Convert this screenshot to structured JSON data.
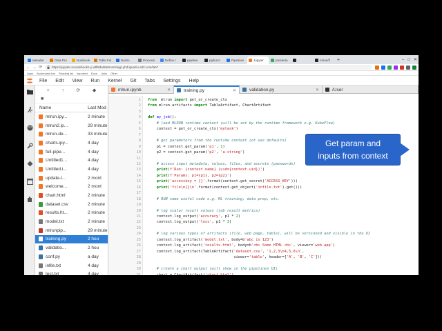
{
  "browser": {
    "tabs": [
      {
        "label": "Metadat",
        "color": "#1a73e8"
      },
      {
        "label": "Data Pro",
        "color": "#e37400"
      },
      {
        "label": "Notebook",
        "color": "#f9ab00"
      },
      {
        "label": "Table Ful",
        "color": "#e37400"
      },
      {
        "label": "Nuclio",
        "color": "#1a73e8"
      },
      {
        "label": "Processi",
        "color": "#777777"
      },
      {
        "label": "Define t",
        "color": "#4285f4"
      },
      {
        "label": "pipeline",
        "color": "#222222"
      },
      {
        "label": "pipfunct",
        "color": "#222222"
      },
      {
        "label": "Pipelines",
        "color": "#1a73e8"
      },
      {
        "label": "Jupyter",
        "color": "#f37626",
        "active": true
      },
      {
        "label": "presenta",
        "color": "#34a853"
      },
      {
        "label": "",
        "color": "#222222"
      },
      {
        "label": "mlrun/fl",
        "color": "#222222"
      }
    ],
    "new_tab": "+",
    "window_controls": [
      "–",
      "□",
      "✕"
    ],
    "nav": {
      "back": "←",
      "forward": "→",
      "reload": "⟳"
    },
    "url": "https://jupyter-noootebook1-y-wfll8dwlkle8-terrnayp.yhd.lguazio-sd2.com/lab?",
    "extension_colors": [
      "#e8710a",
      "#1a73e8",
      "#34a853",
      "#9334e6",
      "#d93025",
      "#5f6368",
      "#188038"
    ],
    "bookmarks": [
      "Apps",
      "Bookmarks bar",
      "Reading list",
      "Imported",
      "Docs",
      "Links",
      "Other"
    ]
  },
  "menu": [
    "File",
    "Edit",
    "View",
    "Run",
    "Kernel",
    "Git",
    "Tabs",
    "Settings",
    "Help"
  ],
  "filebrowser": {
    "toolbar": {
      "new": "+",
      "upload": "↑",
      "refresh": "⟳",
      "git": "◆"
    },
    "breadcrumb": "■",
    "header": {
      "name": "Name",
      "modified": "Last Mod"
    },
    "files": [
      {
        "name": "mlrun.ipy...",
        "modified": "2 minute",
        "color": "#f37626"
      },
      {
        "name": "mlrun2.ip...",
        "modified": "29 minute",
        "color": "#f37626"
      },
      {
        "name": "mlrun-de...",
        "modified": "33 minute",
        "color": "#f37626"
      },
      {
        "name": "charts.ipy...",
        "modified": "4 day",
        "color": "#f37626"
      },
      {
        "name": "full-pipe...",
        "modified": "4 day",
        "color": "#f37626"
      },
      {
        "name": "Untitled1...",
        "modified": "4 day",
        "color": "#f37626"
      },
      {
        "name": "Untitled.i...",
        "modified": "4 day",
        "color": "#f37626"
      },
      {
        "name": "update-t...",
        "modified": "2 mont",
        "color": "#f37626"
      },
      {
        "name": "welcome...",
        "modified": "2 mont",
        "color": "#f37626"
      },
      {
        "name": "chart.html",
        "modified": "2 minute",
        "color": "#e44d26"
      },
      {
        "name": "dataset.csv",
        "modified": "2 minute",
        "color": "#3c9a3c"
      },
      {
        "name": "results.ht...",
        "modified": "2 minute",
        "color": "#e44d26"
      },
      {
        "name": "model.txt",
        "modified": "2 minute",
        "color": "#777777"
      },
      {
        "name": "mlrunpip...",
        "modified": "29 minute",
        "color": "#c0392b"
      },
      {
        "name": "training.py",
        "modified": "2 hou",
        "color": "#ffffff",
        "selected": true
      },
      {
        "name": "validatio...",
        "modified": "2 hou",
        "color": "#3572a5"
      },
      {
        "name": "conf.py",
        "modified": "a day",
        "color": "#3572a5"
      },
      {
        "name": "infile.txt",
        "modified": "4 day",
        "color": "#777777"
      },
      {
        "name": "test.txt",
        "modified": "4 day",
        "color": "#777777"
      }
    ]
  },
  "editor": {
    "tabs": [
      {
        "label": "mlrun.ipynb",
        "active": false,
        "color": "#f37626"
      },
      {
        "label": "training.py",
        "active": true,
        "color": "#3572a5"
      },
      {
        "label": "validation.py",
        "active": false,
        "color": "#3572a5"
      },
      {
        "label": "/User",
        "active": false,
        "color": "#333333"
      }
    ],
    "close_glyph": "✕",
    "line_numbers": [
      "1",
      "2",
      "3",
      "4",
      "5",
      "6",
      "7",
      "8",
      "9",
      "10",
      "11",
      "12",
      "13",
      "14",
      "15",
      "16",
      "17",
      "18",
      "19",
      "20",
      "21",
      "22",
      "23",
      "24",
      "25",
      "26",
      "27",
      "28",
      "29",
      "30",
      "31"
    ],
    "code": [
      [
        [
          "kw",
          "from"
        ],
        [
          "",
          "  mlrun "
        ],
        [
          "kw",
          "import"
        ],
        [
          "",
          " get_or_create_ctx"
        ]
      ],
      [
        [
          "kw",
          "from"
        ],
        [
          "",
          " mlrun.artifacts "
        ],
        [
          "kw",
          "import"
        ],
        [
          "",
          " TableArtifact, ChartArtifact"
        ]
      ],
      [
        [
          "",
          ""
        ]
      ],
      [
        [
          "kw",
          "def"
        ],
        [
          "",
          " "
        ],
        [
          "fn",
          "my_job"
        ],
        [
          "",
          "():"
        ]
      ],
      [
        [
          "",
          "    "
        ],
        [
          "cm",
          "# load MLRUN runtime context (will be set by the runtime framework e.g. KubeFlow)"
        ]
      ],
      [
        [
          "",
          "    context = get_or_create_ctx("
        ],
        [
          "st",
          "'mytask'"
        ],
        [
          "",
          ")"
        ]
      ],
      [
        [
          "",
          ""
        ]
      ],
      [
        [
          "",
          "    "
        ],
        [
          "cm",
          "# get parameters from the runtime context (or use defaults)"
        ]
      ],
      [
        [
          "",
          "    p1 = context.get_param("
        ],
        [
          "st",
          "'p1'"
        ],
        [
          "",
          ", "
        ],
        [
          "nu",
          "1"
        ],
        [
          "",
          ")"
        ]
      ],
      [
        [
          "",
          "    p2 = context.get_param("
        ],
        [
          "st",
          "'p2'"
        ],
        [
          "",
          ", "
        ],
        [
          "st",
          "'a-string'"
        ],
        [
          "",
          ")"
        ]
      ],
      [
        [
          "",
          ""
        ]
      ],
      [
        [
          "",
          "    "
        ],
        [
          "cm",
          "# access input metadata, values, files, and secrets (passwords)"
        ]
      ],
      [
        [
          "",
          "    "
        ],
        [
          "kw",
          "print"
        ],
        [
          "",
          "("
        ],
        [
          "st",
          "f'Run: {context.name} (uid={context.uid})'"
        ],
        [
          "",
          ")"
        ]
      ],
      [
        [
          "",
          "    "
        ],
        [
          "kw",
          "print"
        ],
        [
          "",
          "("
        ],
        [
          "st",
          "f'Params: p1={p1}, p2={p2}'"
        ],
        [
          "",
          ")"
        ]
      ],
      [
        [
          "",
          "    "
        ],
        [
          "kw",
          "print"
        ],
        [
          "",
          "("
        ],
        [
          "st",
          "'accesskey = {}'"
        ],
        [
          "",
          ".format(context.get_secret("
        ],
        [
          "st",
          "'ACCESS_KEY'"
        ],
        [
          "",
          ")))"
        ]
      ],
      [
        [
          "",
          "    "
        ],
        [
          "kw",
          "print"
        ],
        [
          "",
          "("
        ],
        [
          "st",
          "'file\\n{}\\n'"
        ],
        [
          "",
          ".format(context.get_object("
        ],
        [
          "st",
          "'infile.txt'"
        ],
        [
          "",
          ").get()))"
        ]
      ],
      [
        [
          "",
          ""
        ]
      ],
      [
        [
          "",
          "    "
        ],
        [
          "cm",
          "# RUN some useful code e.g. ML training, data prep, etc."
        ]
      ],
      [
        [
          "",
          ""
        ]
      ],
      [
        [
          "",
          "    "
        ],
        [
          "cm",
          "# log scalar result values (job result metrics)"
        ]
      ],
      [
        [
          "",
          "    context.log_output("
        ],
        [
          "st",
          "'accuracy'"
        ],
        [
          "",
          ", p1 * "
        ],
        [
          "nu",
          "2"
        ],
        [
          "",
          ")"
        ]
      ],
      [
        [
          "",
          "    context.log_output("
        ],
        [
          "st",
          "'loss'"
        ],
        [
          "",
          ", p1 * "
        ],
        [
          "nu",
          "3"
        ],
        [
          "",
          ")"
        ]
      ],
      [
        [
          "",
          ""
        ]
      ],
      [
        [
          "",
          "    "
        ],
        [
          "cm",
          "# log various types of artifacts (file, web page, table), will be versioned and visible in the UI"
        ]
      ],
      [
        [
          "",
          "    context.log_artifact("
        ],
        [
          "st",
          "'model.txt'"
        ],
        [
          "",
          ", body=b"
        ],
        [
          "st",
          "'abc is 123'"
        ],
        [
          "",
          ")"
        ]
      ],
      [
        [
          "",
          "    context.log_artifact("
        ],
        [
          "st",
          "'results.html'"
        ],
        [
          "",
          ", body=b"
        ],
        [
          "st",
          "'<b> Some HTML <b>'"
        ],
        [
          "",
          ", viewer="
        ],
        [
          "st",
          "'web-app'"
        ],
        [
          "",
          ")"
        ]
      ],
      [
        [
          "",
          "    context.log_artifact(TableArtifact("
        ],
        [
          "st",
          "'dataset.csv'"
        ],
        [
          "",
          ", "
        ],
        [
          "st",
          "'1,2,3\\n4,5,6\\n'"
        ],
        [
          "",
          ","
        ]
      ],
      [
        [
          "",
          "                                       viewer="
        ],
        [
          "st",
          "'table'"
        ],
        [
          "",
          ", header=["
        ],
        [
          "st",
          "'A'"
        ],
        [
          "",
          ", "
        ],
        [
          "st",
          "'B'"
        ],
        [
          "",
          ", "
        ],
        [
          "st",
          "'C'"
        ],
        [
          "",
          "]))"
        ]
      ],
      [
        [
          "",
          ""
        ]
      ],
      [
        [
          "",
          "    "
        ],
        [
          "cm",
          "# create a chart output (will show in the pipelines UI)"
        ]
      ],
      [
        [
          "",
          "    chart = ChartArtifact("
        ],
        [
          "st",
          "'chart.html'"
        ],
        [
          "",
          ")"
        ]
      ]
    ]
  },
  "callout": {
    "line1": "Get param and",
    "line2": "inputs from context",
    "color": "#2a66c9"
  }
}
